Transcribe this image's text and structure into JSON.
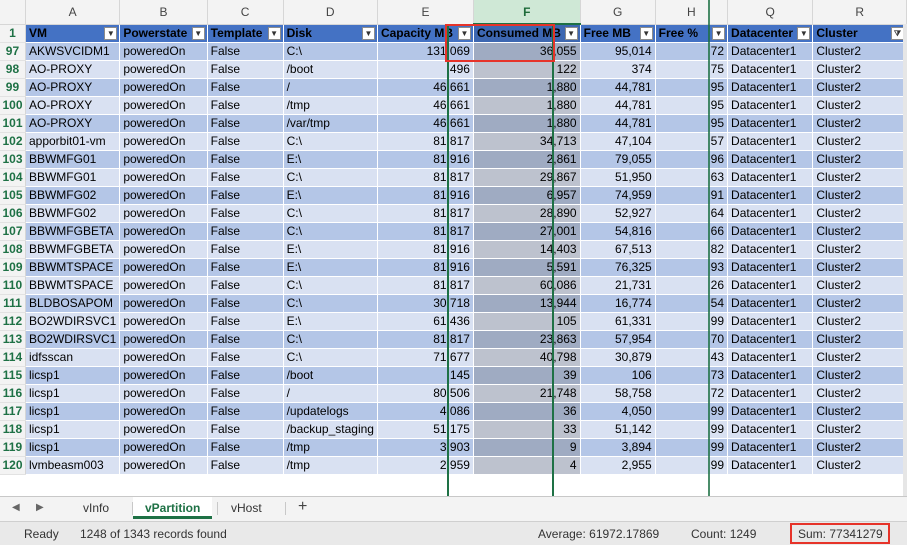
{
  "column_letters": [
    "A",
    "B",
    "C",
    "D",
    "E",
    "F",
    "G",
    "H",
    "Q",
    "R"
  ],
  "selected_column": "F",
  "header_row": {
    "row_number": "1",
    "cells": [
      "VM",
      "Powerstate",
      "Template",
      "Disk",
      "Capacity MB",
      "Consumed MB",
      "Free MB",
      "Free %",
      "Datacenter",
      "Cluster"
    ]
  },
  "rows": [
    {
      "rn": "97",
      "cells": [
        "AKWSVCIDM1",
        "poweredOn",
        "False",
        "C:\\",
        "131,069",
        "36,055",
        "95,014",
        "72",
        "Datacenter1",
        "Cluster2"
      ]
    },
    {
      "rn": "98",
      "cells": [
        "AO-PROXY",
        "poweredOn",
        "False",
        "/boot",
        "496",
        "122",
        "374",
        "75",
        "Datacenter1",
        "Cluster2"
      ]
    },
    {
      "rn": "99",
      "cells": [
        "AO-PROXY",
        "poweredOn",
        "False",
        "/",
        "46,661",
        "1,880",
        "44,781",
        "95",
        "Datacenter1",
        "Cluster2"
      ]
    },
    {
      "rn": "100",
      "cells": [
        "AO-PROXY",
        "poweredOn",
        "False",
        "/tmp",
        "46,661",
        "1,880",
        "44,781",
        "95",
        "Datacenter1",
        "Cluster2"
      ]
    },
    {
      "rn": "101",
      "cells": [
        "AO-PROXY",
        "poweredOn",
        "False",
        "/var/tmp",
        "46,661",
        "1,880",
        "44,781",
        "95",
        "Datacenter1",
        "Cluster2"
      ]
    },
    {
      "rn": "102",
      "cells": [
        "apporbit01-vm",
        "poweredOn",
        "False",
        "C:\\",
        "81,817",
        "34,713",
        "47,104",
        "57",
        "Datacenter1",
        "Cluster2"
      ]
    },
    {
      "rn": "103",
      "cells": [
        "BBWMFG01",
        "poweredOn",
        "False",
        "E:\\",
        "81,916",
        "2,861",
        "79,055",
        "96",
        "Datacenter1",
        "Cluster2"
      ]
    },
    {
      "rn": "104",
      "cells": [
        "BBWMFG01",
        "poweredOn",
        "False",
        "C:\\",
        "81,817",
        "29,867",
        "51,950",
        "63",
        "Datacenter1",
        "Cluster2"
      ]
    },
    {
      "rn": "105",
      "cells": [
        "BBWMFG02",
        "poweredOn",
        "False",
        "E:\\",
        "81,916",
        "6,957",
        "74,959",
        "91",
        "Datacenter1",
        "Cluster2"
      ]
    },
    {
      "rn": "106",
      "cells": [
        "BBWMFG02",
        "poweredOn",
        "False",
        "C:\\",
        "81,817",
        "28,890",
        "52,927",
        "64",
        "Datacenter1",
        "Cluster2"
      ]
    },
    {
      "rn": "107",
      "cells": [
        "BBWMFGBETA",
        "poweredOn",
        "False",
        "C:\\",
        "81,817",
        "27,001",
        "54,816",
        "66",
        "Datacenter1",
        "Cluster2"
      ]
    },
    {
      "rn": "108",
      "cells": [
        "BBWMFGBETA",
        "poweredOn",
        "False",
        "E:\\",
        "81,916",
        "14,403",
        "67,513",
        "82",
        "Datacenter1",
        "Cluster2"
      ]
    },
    {
      "rn": "109",
      "cells": [
        "BBWMTSPACE",
        "poweredOn",
        "False",
        "E:\\",
        "81,916",
        "5,591",
        "76,325",
        "93",
        "Datacenter1",
        "Cluster2"
      ]
    },
    {
      "rn": "110",
      "cells": [
        "BBWMTSPACE",
        "poweredOn",
        "False",
        "C:\\",
        "81,817",
        "60,086",
        "21,731",
        "26",
        "Datacenter1",
        "Cluster2"
      ]
    },
    {
      "rn": "111",
      "cells": [
        "BLDBOSAPOM",
        "poweredOn",
        "False",
        "C:\\",
        "30,718",
        "13,944",
        "16,774",
        "54",
        "Datacenter1",
        "Cluster2"
      ]
    },
    {
      "rn": "112",
      "cells": [
        "BO2WDIRSVC1",
        "poweredOn",
        "False",
        "E:\\",
        "61,436",
        "105",
        "61,331",
        "99",
        "Datacenter1",
        "Cluster2"
      ]
    },
    {
      "rn": "113",
      "cells": [
        "BO2WDIRSVC1",
        "poweredOn",
        "False",
        "C:\\",
        "81,817",
        "23,863",
        "57,954",
        "70",
        "Datacenter1",
        "Cluster2"
      ]
    },
    {
      "rn": "114",
      "cells": [
        "idfsscan",
        "poweredOn",
        "False",
        "C:\\",
        "71,677",
        "40,798",
        "30,879",
        "43",
        "Datacenter1",
        "Cluster2"
      ]
    },
    {
      "rn": "115",
      "cells": [
        "licsp1",
        "poweredOn",
        "False",
        "/boot",
        "145",
        "39",
        "106",
        "73",
        "Datacenter1",
        "Cluster2"
      ]
    },
    {
      "rn": "116",
      "cells": [
        "licsp1",
        "poweredOn",
        "False",
        "/",
        "80,506",
        "21,748",
        "58,758",
        "72",
        "Datacenter1",
        "Cluster2"
      ]
    },
    {
      "rn": "117",
      "cells": [
        "licsp1",
        "poweredOn",
        "False",
        "/updatelogs",
        "4,086",
        "36",
        "4,050",
        "99",
        "Datacenter1",
        "Cluster2"
      ]
    },
    {
      "rn": "118",
      "cells": [
        "licsp1",
        "poweredOn",
        "False",
        "/backup_staging",
        "51,175",
        "33",
        "51,142",
        "99",
        "Datacenter1",
        "Cluster2"
      ]
    },
    {
      "rn": "119",
      "cells": [
        "licsp1",
        "poweredOn",
        "False",
        "/tmp",
        "3,903",
        "9",
        "3,894",
        "99",
        "Datacenter1",
        "Cluster2"
      ]
    },
    {
      "rn": "120",
      "cells": [
        "lvmbeasm003",
        "poweredOn",
        "False",
        "/tmp",
        "2,959",
        "4",
        "2,955",
        "99",
        "Datacenter1",
        "Cluster2"
      ]
    }
  ],
  "numeric_columns": [
    4,
    5,
    6,
    7
  ],
  "sheet_tabs": [
    "vInfo",
    "vPartition",
    "vHost"
  ],
  "active_tab": "vPartition",
  "status": {
    "ready": "Ready",
    "records": "1248 of 1343 records found",
    "average": "Average: 61972.17869",
    "count": "Count: 1249",
    "sum": "Sum: 77341279"
  },
  "colors": {
    "header_fill": "#4472c4",
    "band_dark": "#b4c6e7",
    "band_light": "#d9e1f2",
    "accent": "#1e7145",
    "highlight": "#e63329"
  }
}
